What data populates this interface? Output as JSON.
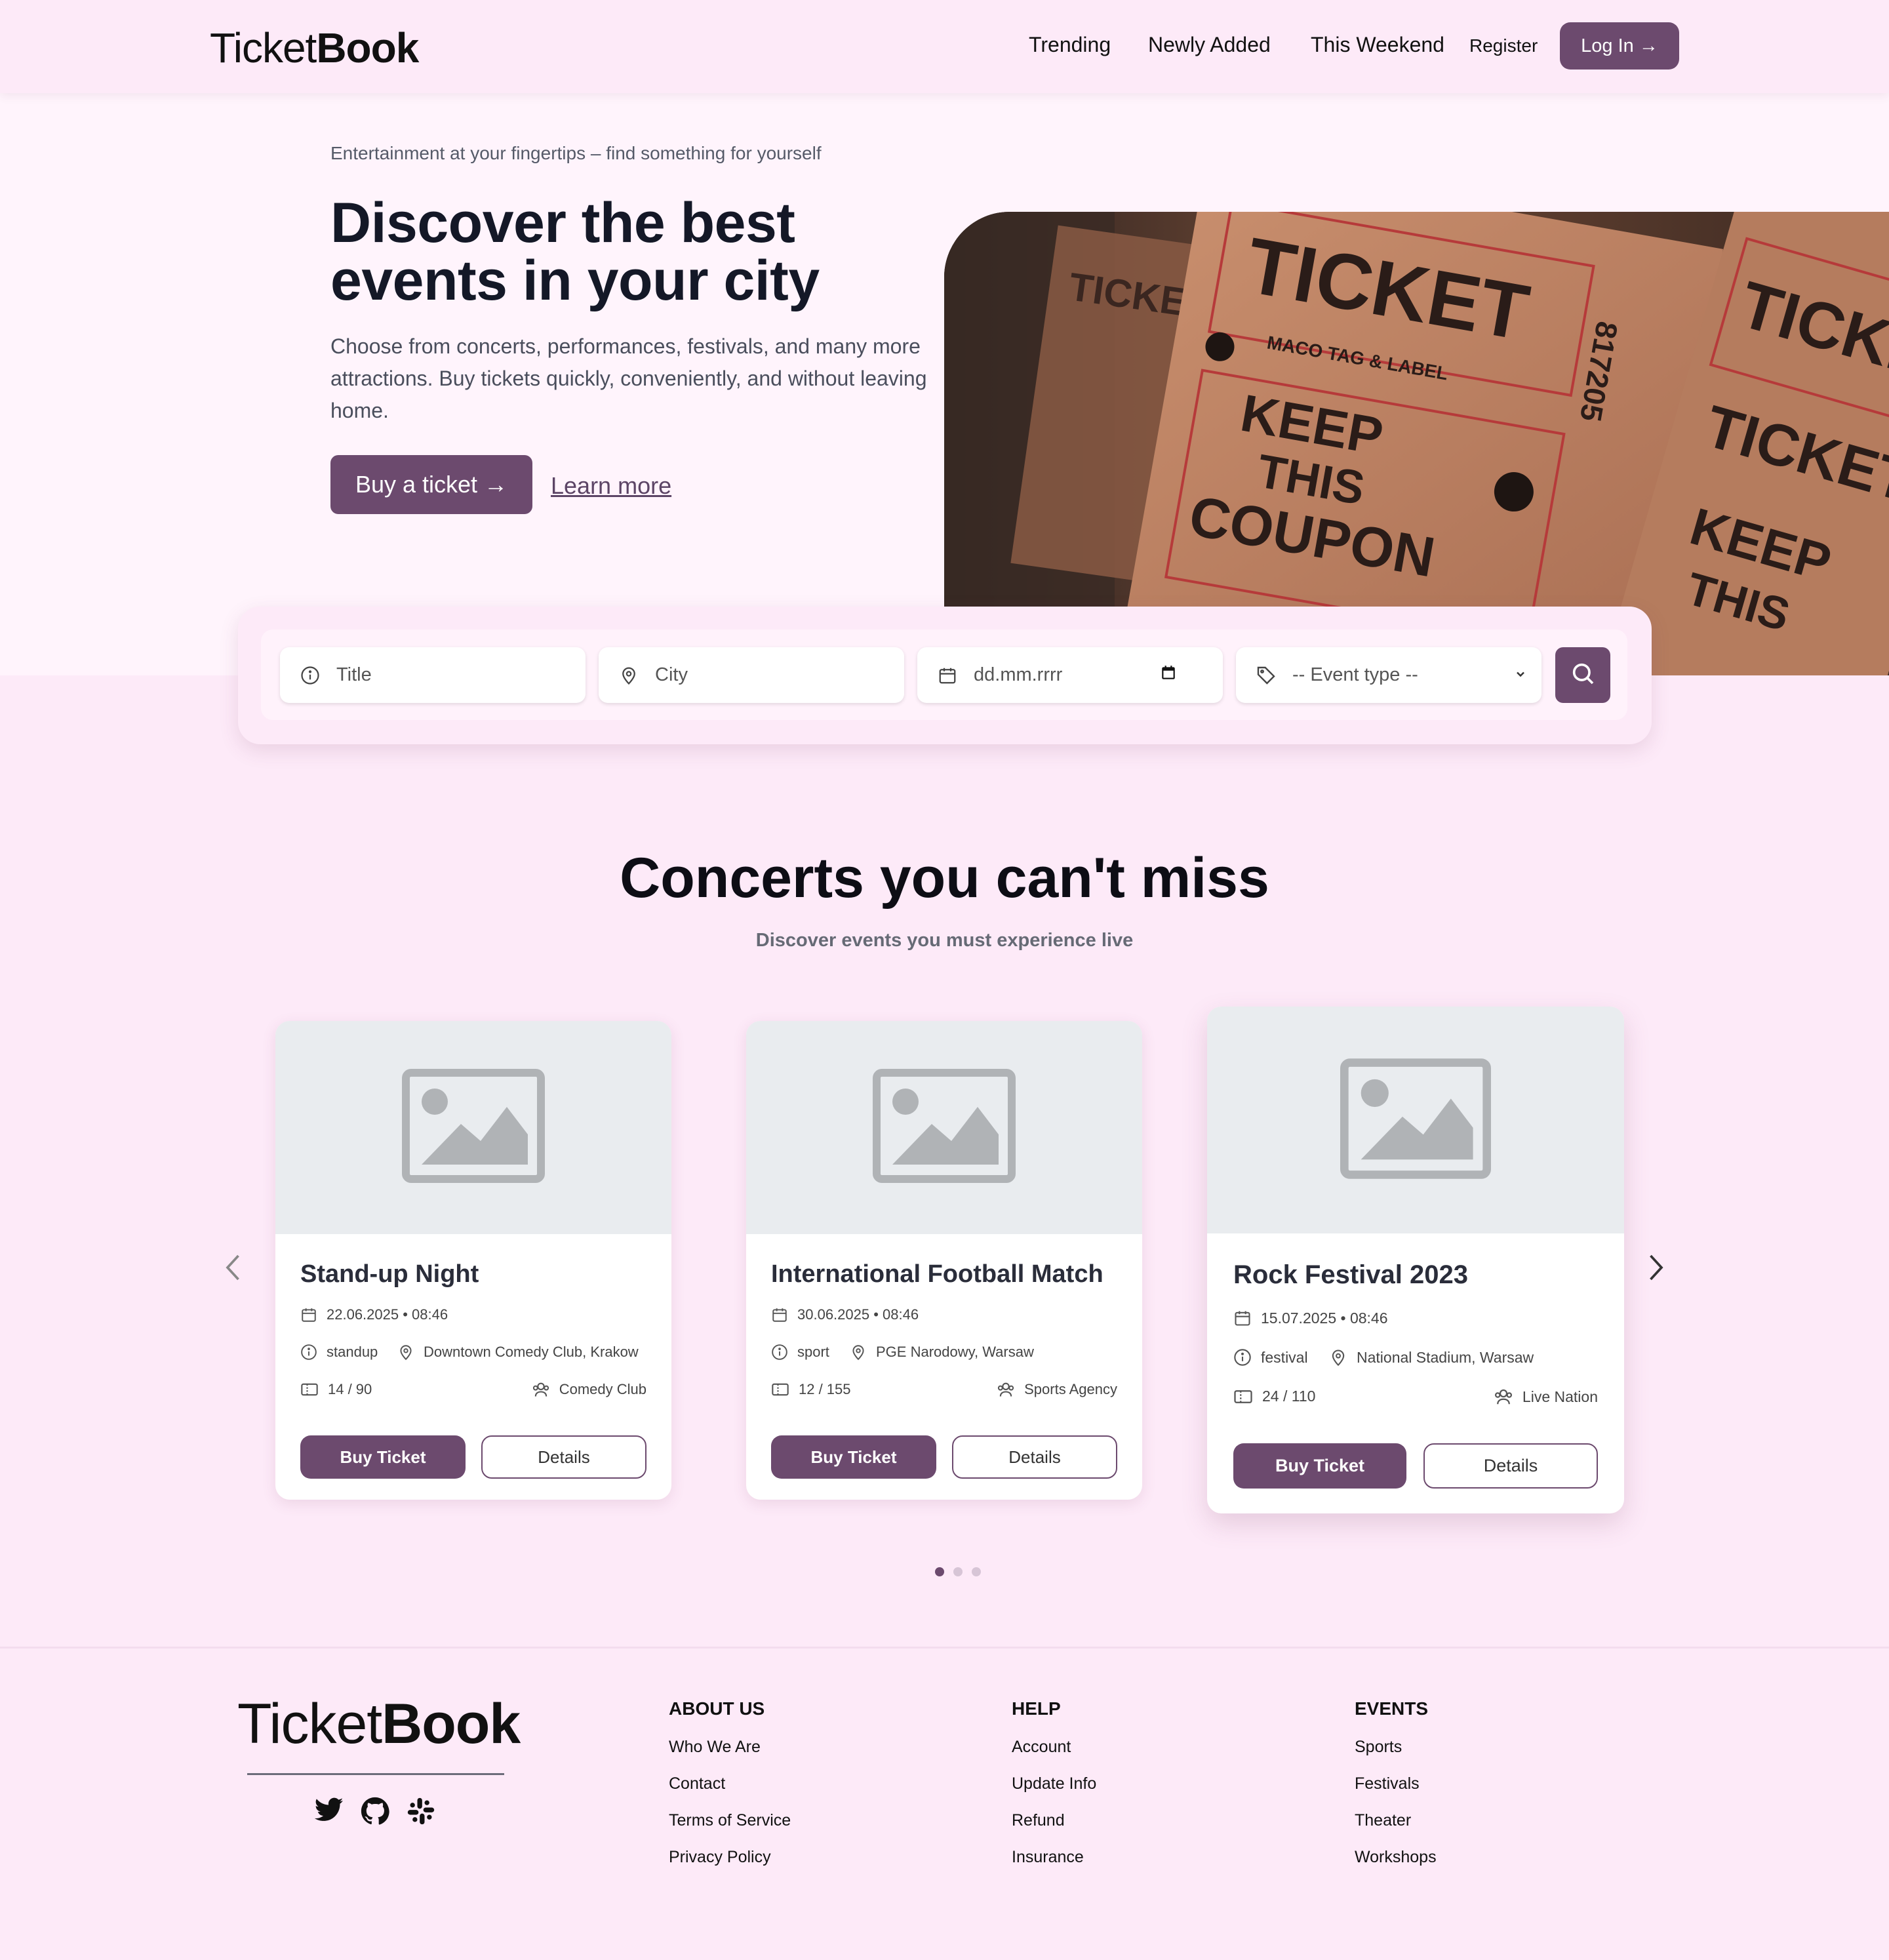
{
  "header": {
    "logo_light": "Ticket",
    "logo_bold": "Book",
    "nav": [
      "Trending",
      "Newly Added",
      "This Weekend"
    ],
    "register": "Register",
    "login": "Log In →"
  },
  "hero": {
    "tagline": "Entertainment at your fingertips – find something for yourself",
    "title_line1": "Discover the best",
    "title_line2": "events in your city",
    "description": "Choose from concerts, performances, festivals, and many more attractions. Buy tickets quickly, conveniently, and without leaving home.",
    "buy_button": "Buy a ticket →",
    "learn_more": "Learn more"
  },
  "search": {
    "title_placeholder": "Title",
    "city_placeholder": "City",
    "date_placeholder": "dd.mm.rrrr",
    "event_type_selected": "-- Event type --"
  },
  "section": {
    "title": "Concerts you can't miss",
    "subtitle": "Discover events you must experience live"
  },
  "cards": [
    {
      "title": "Stand-up Night",
      "datetime": "22.06.2025 • 08:46",
      "category": "standup",
      "venue": "Downtown Comedy Club, Krakow",
      "tickets": "14 / 90",
      "organizer": "Comedy Club",
      "buy": "Buy Ticket",
      "details": "Details"
    },
    {
      "title": "International Football Match",
      "datetime": "30.06.2025 • 08:46",
      "category": "sport",
      "venue": "PGE Narodowy, Warsaw",
      "tickets": "12 / 155",
      "organizer": "Sports Agency",
      "buy": "Buy Ticket",
      "details": "Details"
    },
    {
      "title": "Rock Festival 2023",
      "datetime": "15.07.2025 • 08:46",
      "category": "festival",
      "venue": "National Stadium, Warsaw",
      "tickets": "24 / 110",
      "organizer": "Live Nation",
      "buy": "Buy Ticket",
      "details": "Details"
    }
  ],
  "carousel": {
    "active_dot": 1,
    "dot_count": 3
  },
  "hero_image": {
    "ticket1_line1": "TICKET",
    "ticket1_brand": "MACO TAG & LABEL",
    "ticket1_keep": "KEEP",
    "ticket1_this": "THIS",
    "ticket1_coupon": "COUPON",
    "ticket_number": "817205",
    "ticket2_line1": "TICKET",
    "ticket3_line1": "TICKET",
    "ticket3_keep": "KEEP",
    "ticket3_this": "THIS",
    "ticket0_line1": "TICKET"
  },
  "footer": {
    "logo_light": "Ticket",
    "logo_bold": "Book",
    "columns": [
      {
        "title": "ABOUT US",
        "items": [
          "Who We Are",
          "Contact",
          "Terms of Service",
          "Privacy Policy"
        ]
      },
      {
        "title": "HELP",
        "items": [
          "Account",
          "Update Info",
          "Refund",
          "Insurance"
        ]
      },
      {
        "title": "EVENTS",
        "items": [
          "Sports",
          "Festivals",
          "Theater",
          "Workshops"
        ]
      }
    ]
  },
  "colors": {
    "accent": "#6c4a6e",
    "background": "#fdeaf8",
    "hero_bg": "#fff4fc"
  }
}
